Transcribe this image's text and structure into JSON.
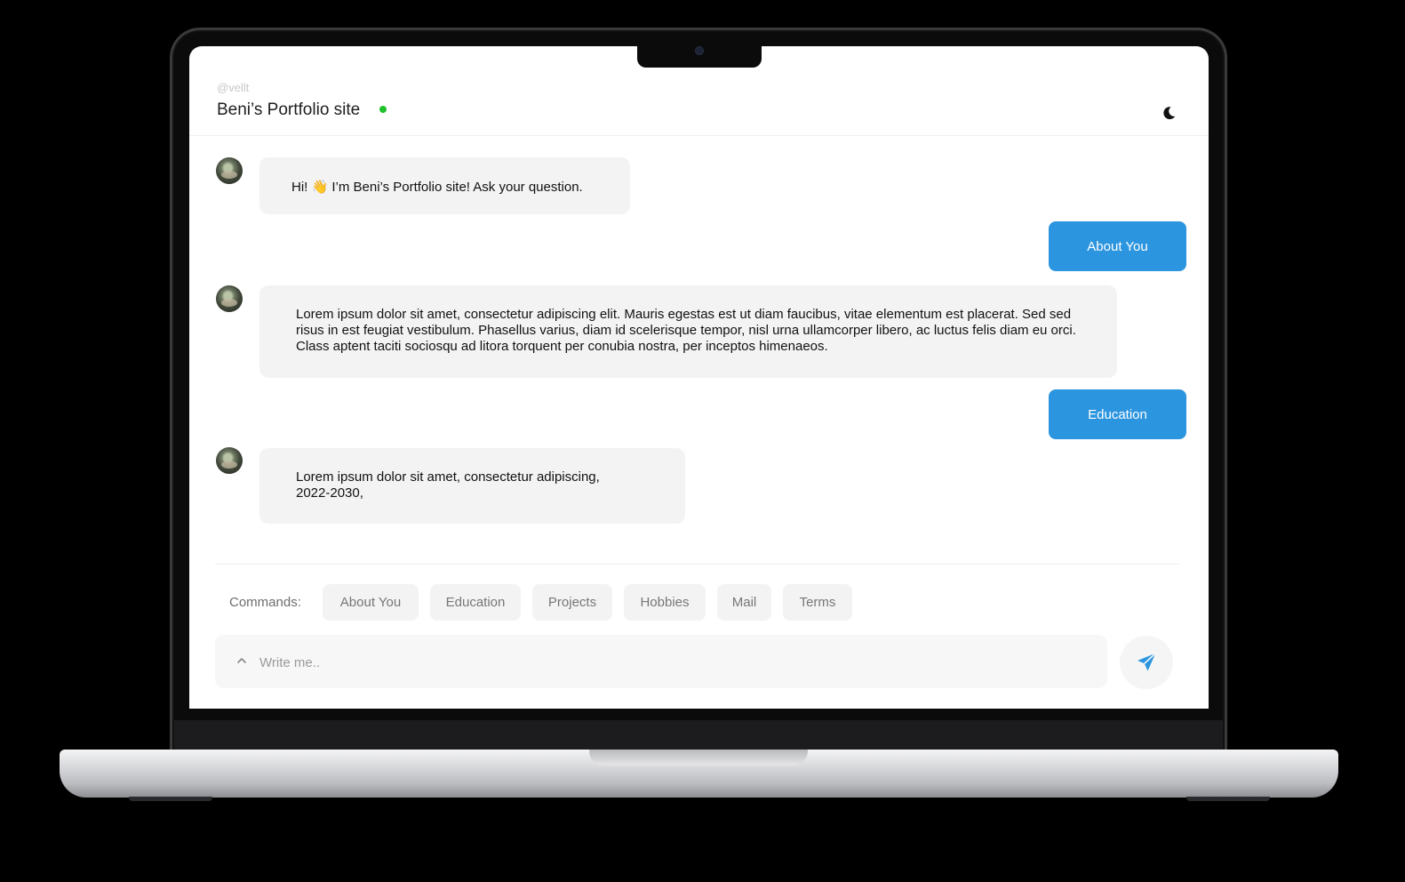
{
  "header": {
    "handle": "@vellt",
    "title": "Beni’s Portfolio site",
    "online_color": "#1fc12a",
    "theme_icon": "moon-icon"
  },
  "messages": [
    {
      "from": "bot",
      "text": "Hi! 👋 I’m Beni’s Portfolio site! Ask your question."
    },
    {
      "from": "user",
      "text": "About You"
    },
    {
      "from": "bot",
      "text": "Lorem ipsum dolor sit amet, consectetur adipiscing elit. Mauris egestas est ut diam faucibus, vitae elementum est placerat. Sed sed risus in est feugiat vestibulum. Phasellus varius, diam id scelerisque tempor, nisl urna ullamcorper libero, ac luctus felis diam eu orci. Class aptent taciti sociosqu ad litora torquent per conubia nostra, per inceptos himenaeos."
    },
    {
      "from": "user",
      "text": "Education"
    },
    {
      "from": "bot",
      "text": "Lorem ipsum dolor sit amet, consectetur adipiscing, 2022-2030,"
    }
  ],
  "commands": {
    "label": "Commands:",
    "items": [
      "About You",
      "Education",
      "Projects",
      "Hobbies",
      "Mail",
      "Terms"
    ]
  },
  "composer": {
    "placeholder": "Write me..",
    "value": "",
    "expand_icon": "chevron-up-icon",
    "send_icon": "send-plane-icon"
  },
  "colors": {
    "accent": "#2c95df",
    "bot_bubble": "#f3f3f3"
  }
}
